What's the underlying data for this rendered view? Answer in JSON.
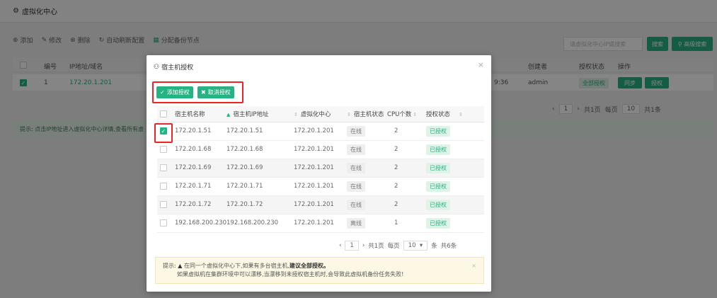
{
  "app": {
    "title": "虚拟化中心"
  },
  "toolbar": {
    "add": "添加",
    "edit": "修改",
    "delete": "删除",
    "auto_refresh": "自动刷新配置",
    "assign_backup": "分配备份节点",
    "search_placeholder": "请虚拟化中心IP或搜索",
    "search_btn": "搜索",
    "advanced_btn": "高级搜索"
  },
  "bg_table": {
    "columns": [
      "编号",
      "IP地址/域名",
      "创建者",
      "授权状态",
      "操作"
    ],
    "row": {
      "no": "1",
      "ip": "172.20.1.201",
      "time": "9:36",
      "creator": "admin",
      "auth": "全部授权",
      "sync": "同步",
      "grant": "授权"
    },
    "pager": {
      "page": "1",
      "total_pages": "共1页",
      "per_page_label": "每页",
      "per_page": "10",
      "total": "共1条"
    },
    "tip": "提示: 点击IP地址进入虚拟化中心详情,查看所有虚"
  },
  "modal": {
    "title": "宿主机授权",
    "btn_add": "添加授权",
    "btn_cancel": "取消授权",
    "columns": [
      "宿主机名称",
      "宿主机IP地址",
      "虚拟化中心",
      "宿主机状态",
      "CPU个数",
      "授权状态"
    ],
    "rows": [
      {
        "name": "172.20.1.51",
        "ip": "172.20.1.51",
        "center": "172.20.1.201",
        "status": "在线",
        "cpu": "2",
        "auth": "已授权",
        "checked": true
      },
      {
        "name": "172.20.1.68",
        "ip": "172.20.1.68",
        "center": "172.20.1.201",
        "status": "在线",
        "cpu": "2",
        "auth": "已授权",
        "checked": false
      },
      {
        "name": "172.20.1.69",
        "ip": "172.20.1.69",
        "center": "172.20.1.201",
        "status": "在线",
        "cpu": "2",
        "auth": "已授权",
        "checked": false
      },
      {
        "name": "172.20.1.71",
        "ip": "172.20.1.71",
        "center": "172.20.1.201",
        "status": "在线",
        "cpu": "2",
        "auth": "已授权",
        "checked": false
      },
      {
        "name": "172.20.1.72",
        "ip": "172.20.1.72",
        "center": "172.20.1.201",
        "status": "在线",
        "cpu": "2",
        "auth": "已授权",
        "checked": false
      },
      {
        "name": "192.168.200.230",
        "ip": "192.168.200.230",
        "center": "172.20.1.201",
        "status": "离线",
        "cpu": "1",
        "auth": "已授权",
        "checked": false
      }
    ],
    "pager": {
      "page": "1",
      "total_pages": "共1页",
      "per_page_label": "每页",
      "per_page": "10",
      "suffix": "条",
      "total": "共6条"
    },
    "tip": {
      "label": "提示:",
      "line1_prefix": "在同一个虚拟化中心下,如果有多台宿主机,",
      "line1_bold": "建议全部授权。",
      "line2": "如果虚拟机在集群环境中可以漂移,当漂移到未授权宿主机时,会导致此虚拟机备份任务失败!"
    }
  },
  "colors": {
    "accent": "#27b283",
    "highlight": "#e8252b"
  }
}
